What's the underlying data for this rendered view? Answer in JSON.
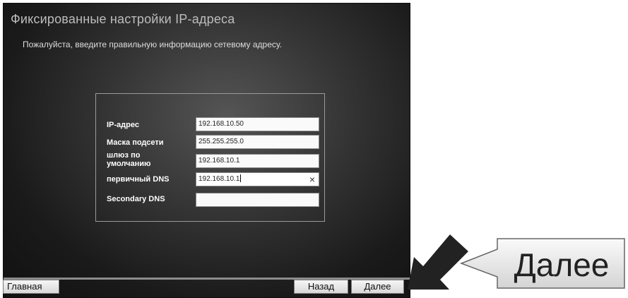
{
  "header": {
    "title": "Фиксированные настройки IP-адреса",
    "subtitle": "Пожалуйста, введите правильную информацию сетевому адресу."
  },
  "form": {
    "fields": [
      {
        "label": "IP-адрес",
        "value": "192.168.10.50"
      },
      {
        "label": "Маска подсети",
        "value": "255.255.255.0"
      },
      {
        "label": "шлюз по умолчанию",
        "value": "192.168.10.1"
      },
      {
        "label": "первичный DNS",
        "value": "192.168.10.1",
        "clear_icon": "×"
      },
      {
        "label": "Secondary DNS",
        "value": ""
      }
    ]
  },
  "footer": {
    "home_label": "Главная",
    "back_label": "Назад",
    "next_label": "Далее"
  },
  "callout": {
    "text": "Далее"
  }
}
